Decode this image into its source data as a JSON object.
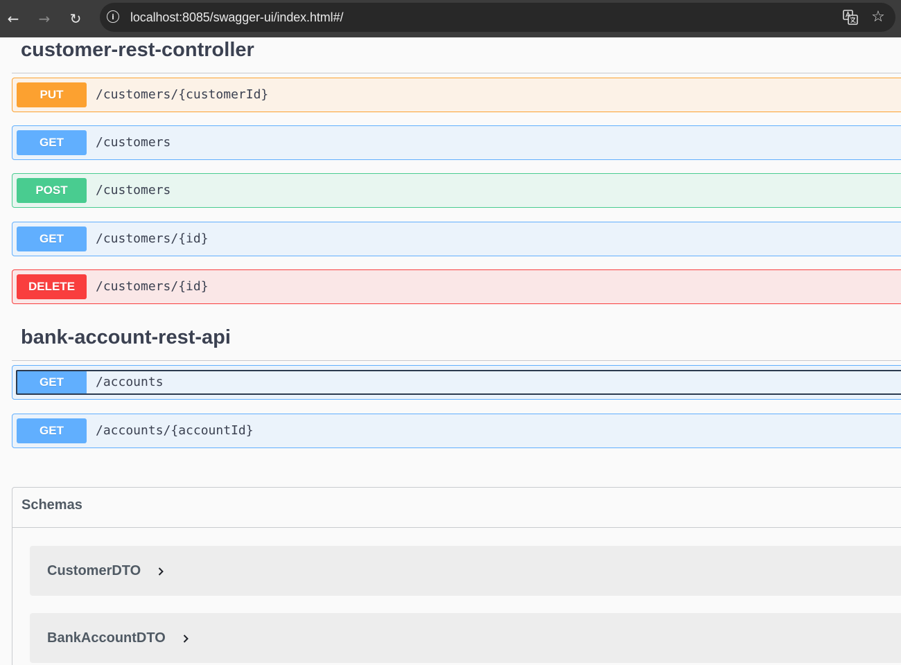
{
  "browser": {
    "url": "localhost:8085/swagger-ui/index.html#/",
    "back_icon": "←",
    "forward_icon": "→",
    "reload_icon": "↻",
    "info_icon": "i",
    "star_icon": "☆"
  },
  "tags": [
    {
      "name": "customer-rest-controller",
      "operations": [
        {
          "method": "PUT",
          "path": "/customers/{customerId}"
        },
        {
          "method": "GET",
          "path": "/customers"
        },
        {
          "method": "POST",
          "path": "/customers"
        },
        {
          "method": "GET",
          "path": "/customers/{id}"
        },
        {
          "method": "DELETE",
          "path": "/customers/{id}"
        }
      ]
    },
    {
      "name": "bank-account-rest-api",
      "operations": [
        {
          "method": "GET",
          "path": "/accounts"
        },
        {
          "method": "GET",
          "path": "/accounts/{accountId}"
        }
      ]
    }
  ],
  "schemas": {
    "title": "Schemas",
    "models": [
      {
        "name": "CustomerDTO"
      },
      {
        "name": "BankAccountDTO"
      }
    ]
  },
  "colors": {
    "put": "#fca130",
    "get": "#61affe",
    "post": "#49cc90",
    "delete": "#f93e3e",
    "text": "#3b4151"
  }
}
